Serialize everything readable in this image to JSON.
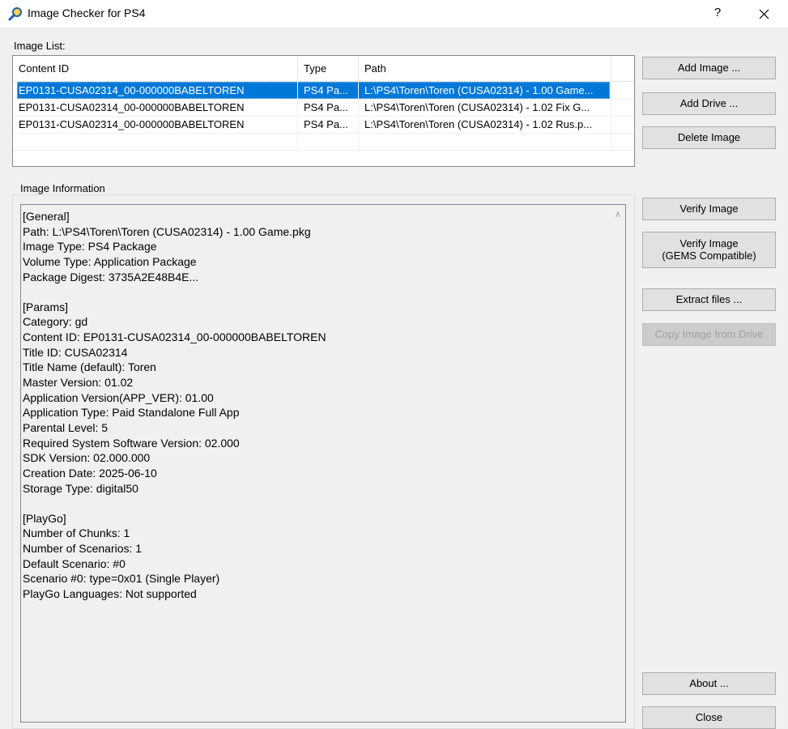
{
  "window": {
    "title": "Image Checker for PS4",
    "help_label": "?"
  },
  "image_list": {
    "label": "Image List:",
    "columns": [
      "Content ID",
      "Type",
      "Path"
    ],
    "rows": [
      {
        "content_id": "EP0131-CUSA02314_00-000000BABELTOREN",
        "type": "PS4 Pa...",
        "path": "L:\\PS4\\Toren\\Toren (CUSA02314) - 1.00 Game...",
        "selected": true
      },
      {
        "content_id": "EP0131-CUSA02314_00-000000BABELTOREN",
        "type": "PS4 Pa...",
        "path": "L:\\PS4\\Toren\\Toren (CUSA02314) - 1.02 Fix G...",
        "selected": false
      },
      {
        "content_id": "EP0131-CUSA02314_00-000000BABELTOREN",
        "type": "PS4 Pa...",
        "path": "L:\\PS4\\Toren\\Toren (CUSA02314) - 1.02 Rus.p...",
        "selected": false
      }
    ]
  },
  "image_information": {
    "label": "Image Information",
    "lines": [
      "[General]",
      "Path: L:\\PS4\\Toren\\Toren (CUSA02314) - 1.00 Game.pkg",
      "Image Type: PS4 Package",
      "Volume Type: Application Package",
      "Package Digest: 3735A2E48B4E...",
      "",
      "[Params]",
      "Category: gd",
      "Content ID: EP0131-CUSA02314_00-000000BABELTOREN",
      "Title ID: CUSA02314",
      "Title Name (default): Toren",
      "Master Version: 01.02",
      "Application Version(APP_VER): 01.00",
      "Application Type: Paid Standalone Full App",
      "Parental Level: 5",
      "Required System Software Version: 02.000",
      "SDK Version: 02.000.000",
      "Creation Date: 2025-06-10",
      "Storage Type: digital50",
      "",
      "[PlayGo]",
      "Number of Chunks: 1",
      "Number of Scenarios: 1",
      "Default Scenario: #0",
      "Scenario #0: type=0x01 (Single Player)",
      "PlayGo Languages: Not supported"
    ]
  },
  "buttons": {
    "add_image": "Add Image ...",
    "add_drive": "Add Drive ...",
    "delete_image": "Delete Image",
    "verify_image": "Verify Image",
    "verify_gems_line1": "Verify Image",
    "verify_gems_line2": "(GEMS Compatible)",
    "extract_files": "Extract files ...",
    "copy_from_drive": "Copy Image from Drive",
    "about": "About ...",
    "close": "Close"
  },
  "colors": {
    "selection": "#0078d7",
    "window_bg": "#f0f0f0",
    "button_bg": "#e1e1e1"
  }
}
